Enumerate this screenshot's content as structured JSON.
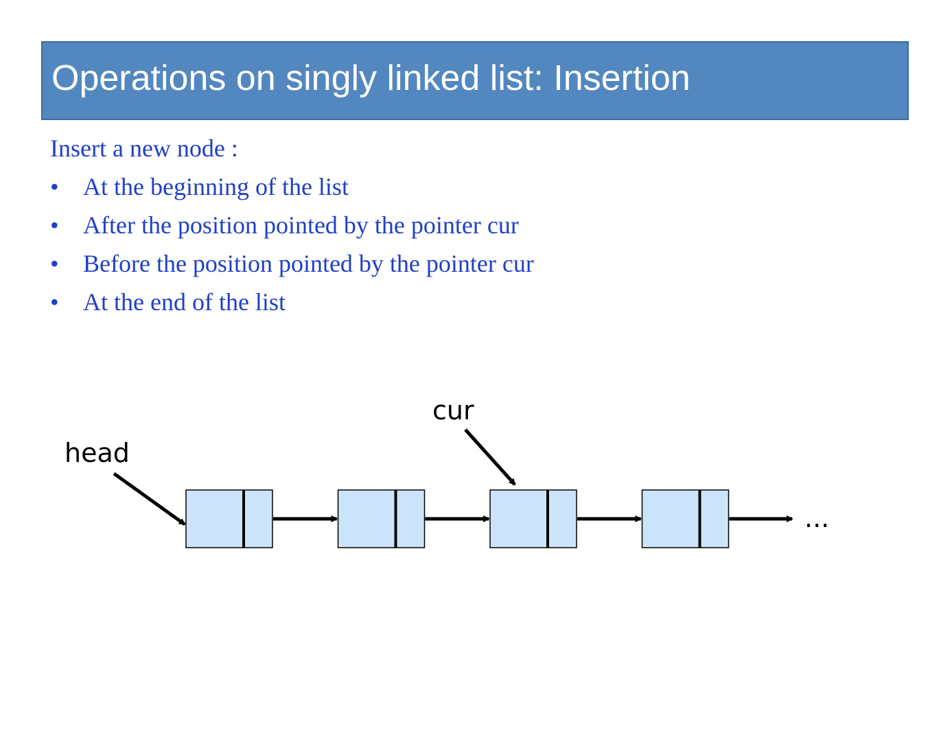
{
  "title": "Operations on singly linked list: Insertion",
  "intro": "Insert a new node :",
  "bullet_symbol": "•",
  "bullets": [
    "At the beginning of the list",
    "After the position pointed by the pointer cur",
    "Before the position pointed by the pointer cur",
    "At the end of the list"
  ],
  "diagram": {
    "head_label": "head",
    "cur_label": "cur",
    "ellipsis": "...",
    "node_count": 4,
    "pointer_targets": {
      "head": 1,
      "cur": 3
    },
    "colors": {
      "node_fill": "#cce4fb",
      "node_stroke": "#000000",
      "arrow": "#000000"
    }
  },
  "colors": {
    "title_bar": "#5387c0",
    "title_text": "#ffffff",
    "body_text": "#1f3fc8"
  }
}
